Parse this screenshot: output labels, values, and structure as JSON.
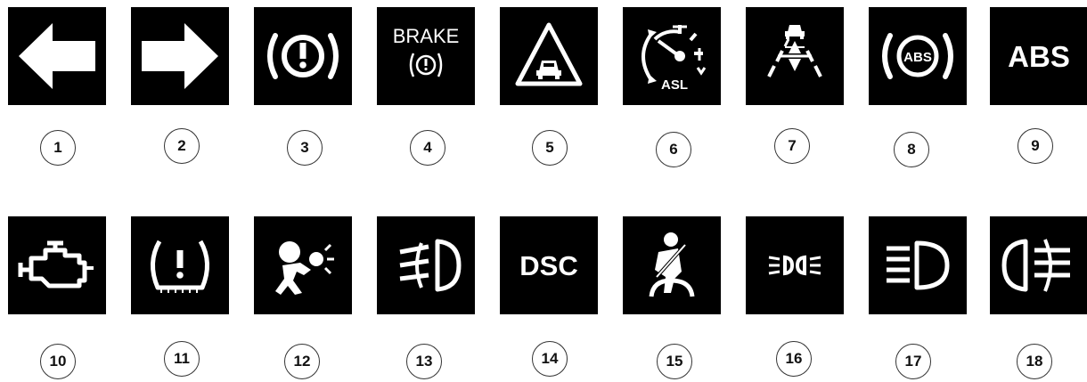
{
  "icons": [
    {
      "number": "1",
      "icon": "left-arrow-icon"
    },
    {
      "number": "2",
      "icon": "right-arrow-icon"
    },
    {
      "number": "3",
      "icon": "brake-warning-icon"
    },
    {
      "number": "4",
      "icon": "brake-text-warning-icon",
      "text": "BRAKE"
    },
    {
      "number": "5",
      "icon": "forward-collision-warning-icon"
    },
    {
      "number": "6",
      "icon": "speed-limiter-asl-icon",
      "text": "ASL"
    },
    {
      "number": "7",
      "icon": "lane-departure-icon"
    },
    {
      "number": "8",
      "icon": "abs-circle-icon",
      "text": "ABS"
    },
    {
      "number": "9",
      "icon": "abs-text-icon",
      "text": "ABS"
    },
    {
      "number": "10",
      "icon": "check-engine-icon"
    },
    {
      "number": "11",
      "icon": "tire-pressure-icon"
    },
    {
      "number": "12",
      "icon": "airbag-icon"
    },
    {
      "number": "13",
      "icon": "front-fog-light-icon"
    },
    {
      "number": "14",
      "icon": "dsc-icon",
      "text": "DSC"
    },
    {
      "number": "15",
      "icon": "seatbelt-icon"
    },
    {
      "number": "16",
      "icon": "side-lights-icon"
    },
    {
      "number": "17",
      "icon": "high-beam-icon"
    },
    {
      "number": "18",
      "icon": "rear-fog-light-icon"
    }
  ],
  "colors": {
    "tile": "#000000",
    "symbol": "#ffffff",
    "label_border": "#333333"
  }
}
